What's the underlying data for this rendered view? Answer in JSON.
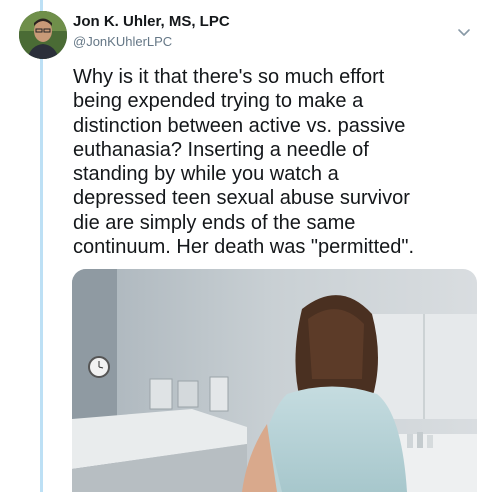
{
  "tweet": {
    "author_name": "Jon K. Uhler, MS, LPC",
    "author_handle": "@JonKUhlerLPC",
    "text_lines": [
      "Why is it that there's so much effort",
      "being expended trying to make a",
      "distinction between active vs. passive",
      "euthanasia? Inserting a needle of",
      "standing by while you watch a",
      "depressed teen sexual abuse survivor",
      "die are simply ends of the same",
      "continuum. Her death was \"permitted\"."
    ],
    "avatar_icon": "person-icon",
    "menu_icon": "chevron-down-icon",
    "media_icon": "photo"
  },
  "colors": {
    "thread_line": "#bde0f5",
    "handle": "#657786",
    "text": "#14171a"
  }
}
